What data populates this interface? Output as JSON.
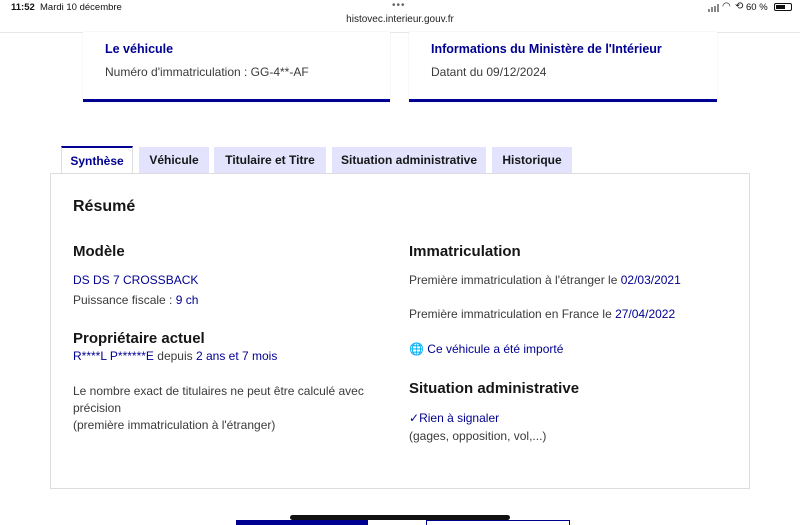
{
  "status_bar": {
    "time": "11:52",
    "date": "Mardi 10 décembre",
    "dots": "•••",
    "url": "histovec.interieur.gouv.fr",
    "battery": "60 %"
  },
  "cards": {
    "vehicle": {
      "title": "Le véhicule",
      "text": "Numéro d'immatriculation : GG-4**-AF"
    },
    "ministry": {
      "title": "Informations du Ministère de l'Intérieur",
      "text": "Datant du 09/12/2024"
    }
  },
  "tabs": [
    {
      "label": "Synthèse",
      "active": true
    },
    {
      "label": "Véhicule",
      "active": false
    },
    {
      "label": "Titulaire et Titre",
      "active": false
    },
    {
      "label": "Situation administrative",
      "active": false
    },
    {
      "label": "Historique",
      "active": false
    }
  ],
  "summary": {
    "title": "Résumé",
    "model": {
      "heading": "Modèle",
      "name": "DS DS 7 CROSSBACK",
      "power_label": "Puissance fiscale : ",
      "power_value": "9 ch"
    },
    "owner": {
      "heading": "Propriétaire actuel",
      "name": "R****L P******E",
      "since_label": " depuis ",
      "since_value": "2 ans et 7 mois",
      "note_line1": "Le nombre exact de titulaires ne peut être calculé avec",
      "note_line2": "précision",
      "note_line3": "(première immatriculation à l'étranger)"
    },
    "registration": {
      "heading": "Immatriculation",
      "foreign_label": "Première immatriculation à l'étranger le ",
      "foreign_date": "02/03/2021",
      "france_label": "Première immatriculation en France le ",
      "france_date": "27/04/2022",
      "imported_link": "Ce véhicule a été importé"
    },
    "admin": {
      "heading": "Situation administrative",
      "status_link": "Rien à signaler",
      "status_note": "(gages, opposition, vol,...)"
    }
  },
  "colors": {
    "primary": "#000091",
    "tab_bg": "#e3e3fd"
  }
}
